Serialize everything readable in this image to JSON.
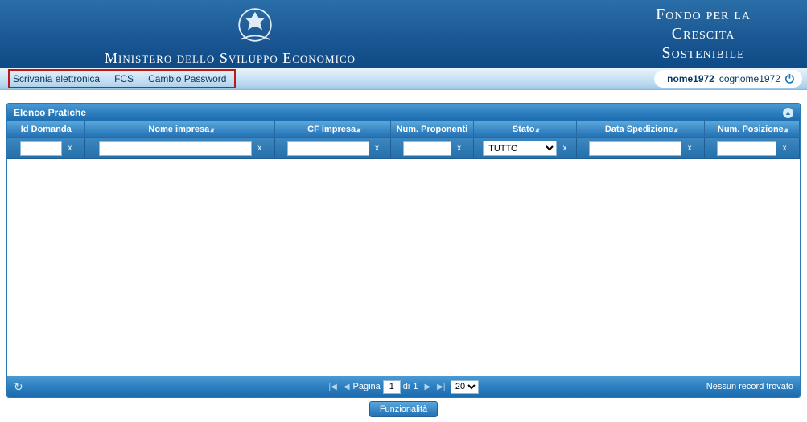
{
  "header": {
    "ministry": "Ministero dello Sviluppo Economico",
    "fund_line1": "Fondo per la",
    "fund_line2": "Crescita",
    "fund_line3": "Sostenibile"
  },
  "nav": {
    "scrivania": "Scrivania elettronica",
    "fcs": "FCS",
    "cambio_pw": "Cambio Password"
  },
  "user": {
    "name": "nome1972",
    "surname": "cognome1972"
  },
  "panel": {
    "title": "Elenco Pratiche",
    "columns": {
      "id_domanda": "Id Domanda",
      "nome_impresa": "Nome impresa",
      "cf_impresa": "CF impresa",
      "num_proponenti": "Num. Proponenti",
      "stato": "Stato",
      "data_spedizione": "Data Spedizione",
      "num_posizione": "Num. Posizione"
    },
    "filters": {
      "id_domanda": "",
      "nome_impresa": "",
      "cf_impresa": "",
      "num_proponenti": "",
      "stato_selected": "TUTTO",
      "stato_options": [
        "TUTTO"
      ],
      "data_spedizione": "",
      "num_posizione": ""
    },
    "clear_label": "x"
  },
  "pager": {
    "page_label_prefix": "Pagina",
    "page_current": "1",
    "page_label_mid": "di",
    "page_total": "1",
    "pagesize_selected": "20",
    "pagesize_options": [
      "20"
    ],
    "no_records": "Nessun record trovato"
  },
  "footer": {
    "funzionalita": "Funzionalità"
  }
}
